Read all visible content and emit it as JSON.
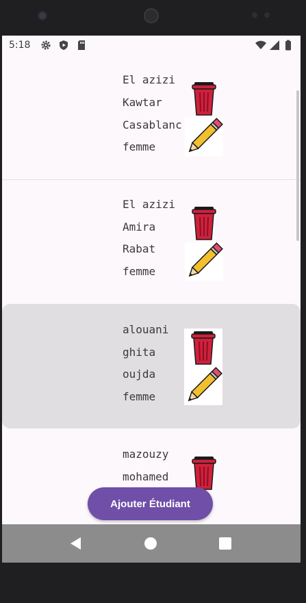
{
  "status_bar": {
    "time": "5:18",
    "left_icons": [
      "gear-icon",
      "shield-play-icon",
      "sd-card-icon"
    ],
    "right_icons": [
      "wifi-icon",
      "signal-icon",
      "battery-icon"
    ]
  },
  "students": [
    {
      "nom": "El azizi",
      "prenom": "Kawtar",
      "ville": "Casablanc",
      "sexe": "femme"
    },
    {
      "nom": "El azizi",
      "prenom": "Amira",
      "ville": "Rabat",
      "sexe": "femme"
    },
    {
      "nom": "alouani",
      "prenom": "ghita",
      "ville": "oujda",
      "sexe": "femme"
    },
    {
      "nom": "mazouzy",
      "prenom": "mohamed",
      "ville": "",
      "sexe": ""
    }
  ],
  "actions": {
    "delete_icon": "trash-icon",
    "edit_icon": "pencil-icon"
  },
  "fab": {
    "label": "Ajouter Étudiant"
  },
  "nav": {
    "back": "back-icon",
    "home": "home-icon",
    "recents": "recents-icon"
  },
  "colors": {
    "primary": "#6f4fa8",
    "trash": "#d0203c",
    "pencil": "#f2c02e",
    "highlight": "#e1dee1"
  }
}
